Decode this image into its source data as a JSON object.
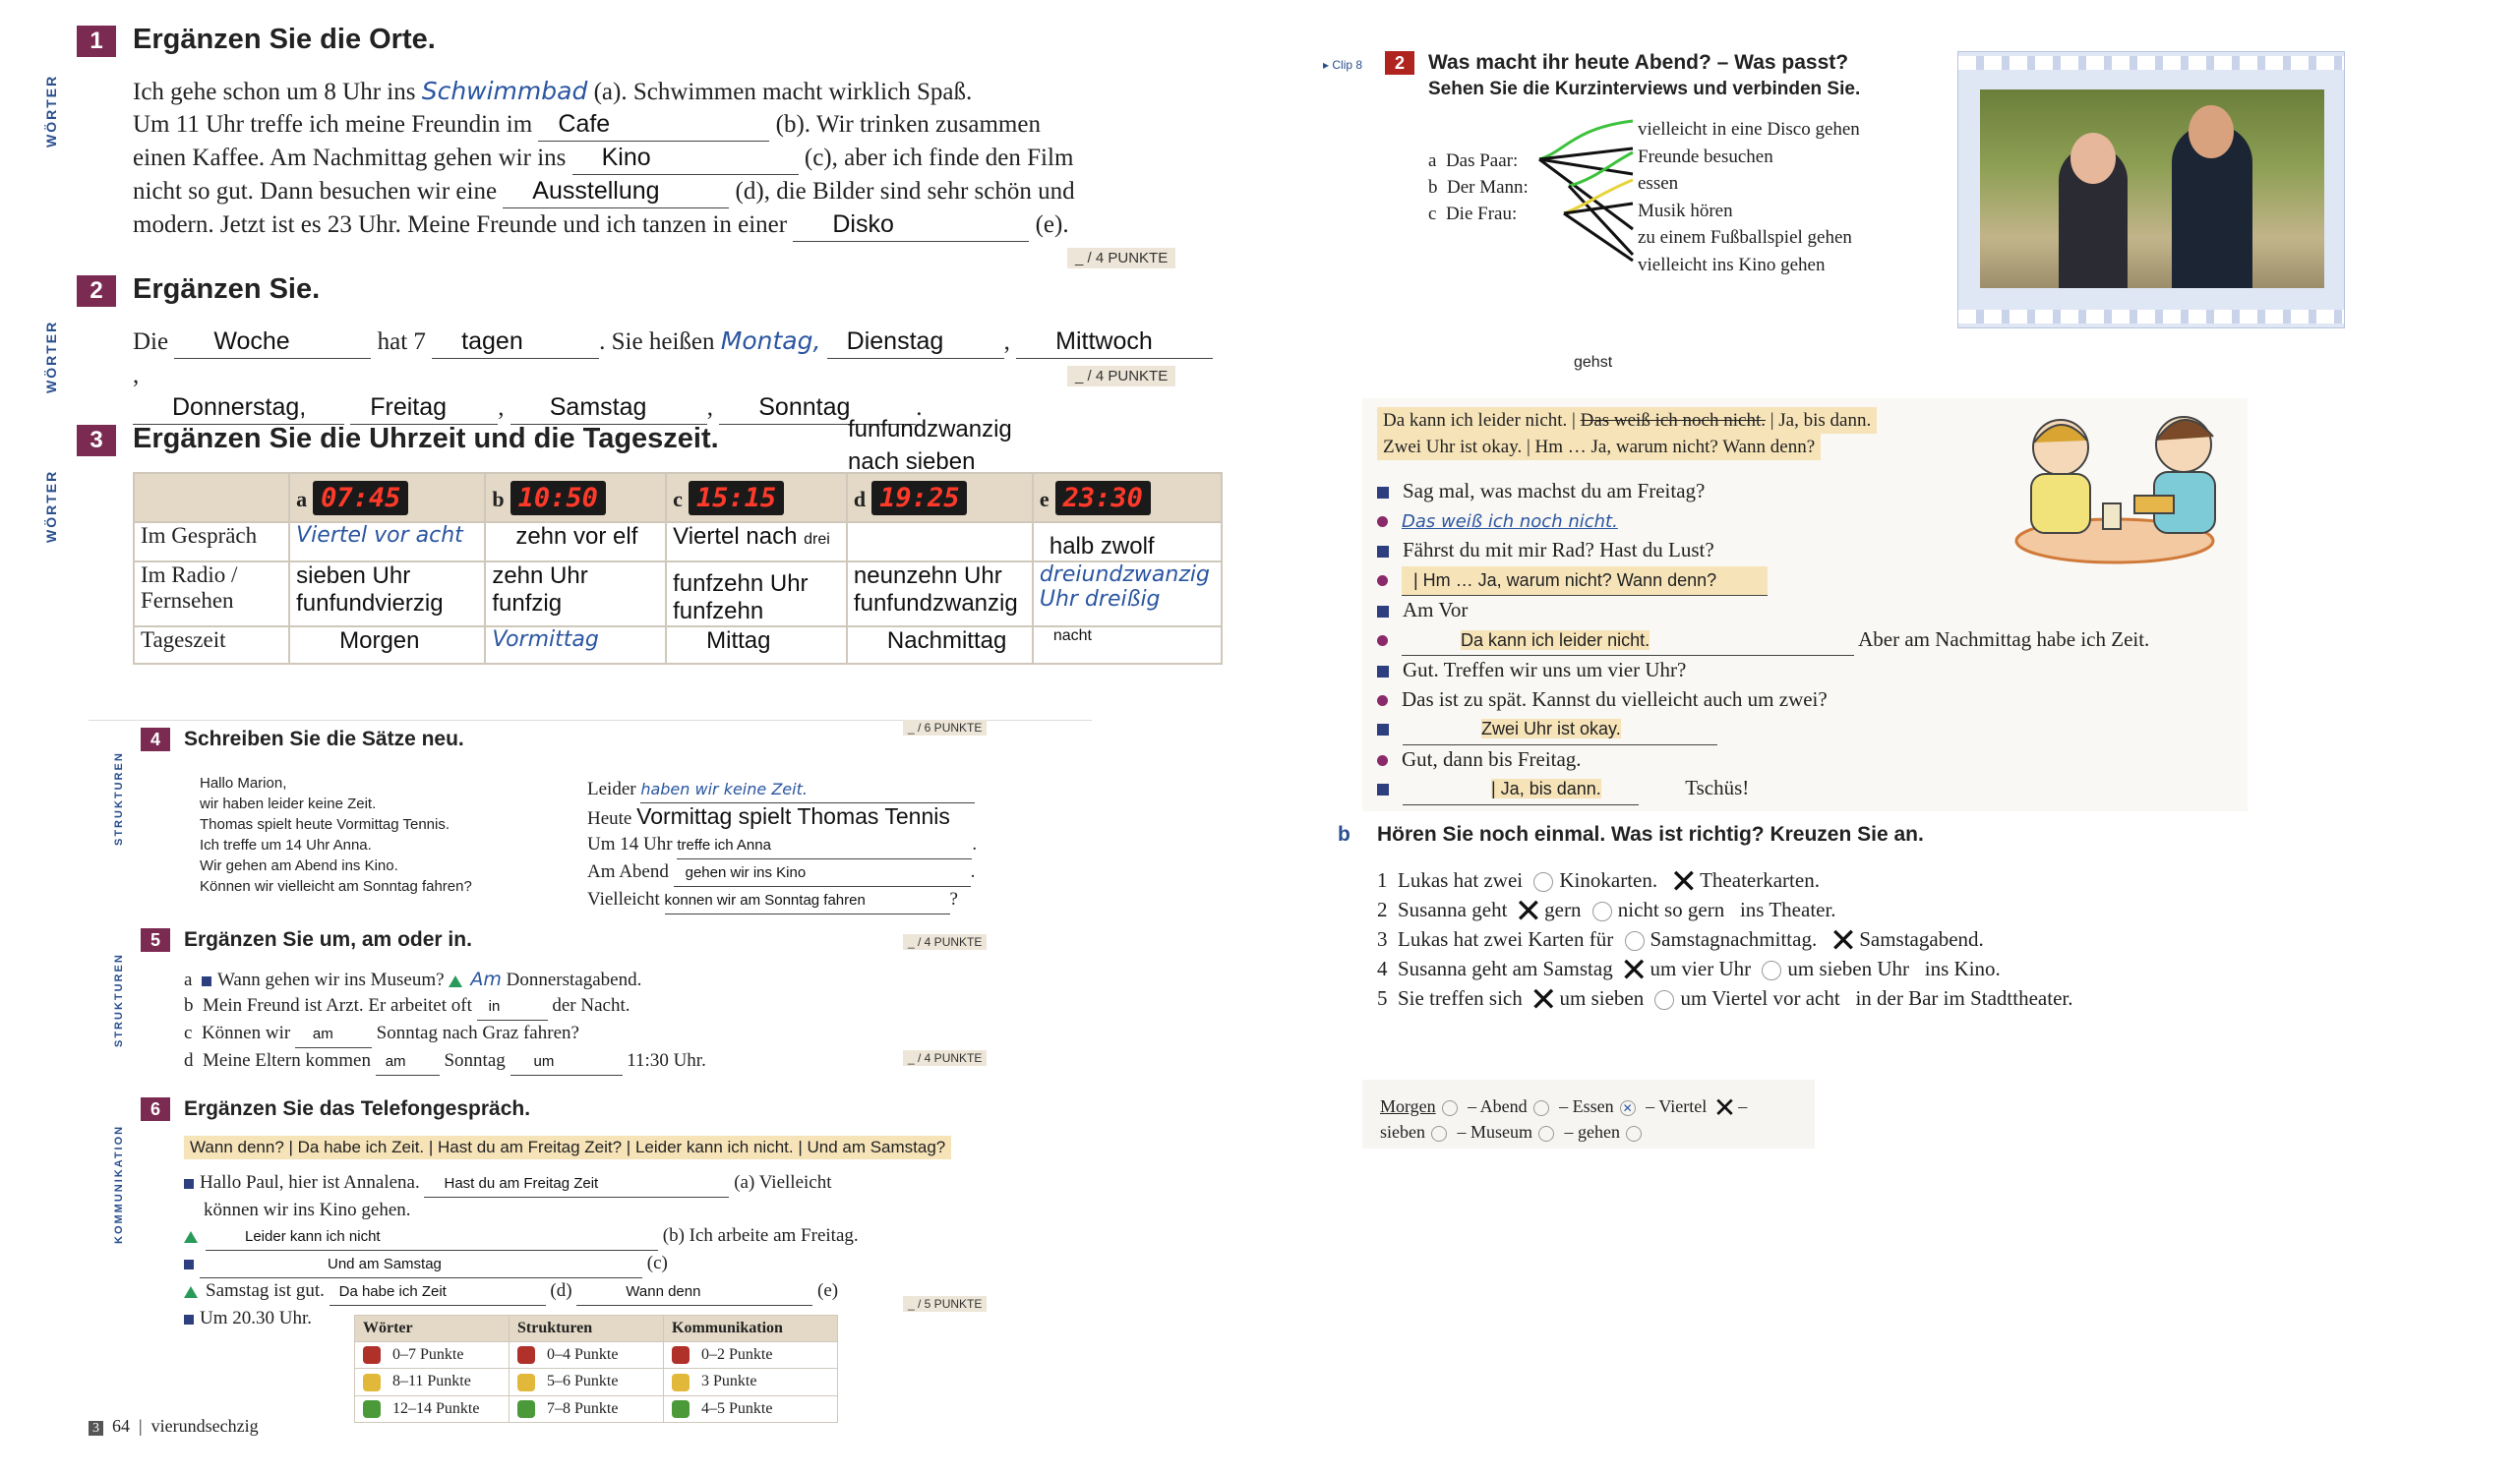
{
  "ex1": {
    "num": "1",
    "title": "Ergänzen Sie die Orte.",
    "side": "WÖRTER",
    "l1_pre": "Ich gehe schon um 8 Uhr ins",
    "l1_hand": "Schwimmbad",
    "l1_post": "(a). Schwimmen macht wirklich Spaß.",
    "l2_pre": "Um 11 Uhr treffe ich meine Freundin im",
    "l2_ans": "Cafe",
    "l2_post": "(b). Wir trinken zusammen",
    "l3_pre": "einen Kaffee. Am Nachmittag gehen wir ins",
    "l3_ans": "Kino",
    "l3_post": "(c), aber ich finde den Film",
    "l4_pre": "nicht so gut. Dann besuchen wir eine",
    "l4_ans": "Ausstellung",
    "l4_post": "(d), die Bilder sind sehr schön und",
    "l5_pre": "modern. Jetzt ist es 23 Uhr. Meine Freunde und ich tanzen in einer",
    "l5_ans": "Disko",
    "l5_post": "(e).",
    "punkte": "_ / 4 PUNKTE"
  },
  "ex2": {
    "num": "2",
    "title": "Ergänzen Sie.",
    "side": "WÖRTER",
    "die": "Die",
    "woche": "Woche",
    "hat7": "hat 7",
    "tagen": "tagen",
    "heissen": ". Sie heißen",
    "montag": "Montag,",
    "dienstag": "Dienstag",
    "comma1": ",",
    "mittwoch": "Mittwoch",
    "comma2": ",",
    "donnerstag": "Donnerstag,",
    "freitag": "Freitag",
    "comma3": ",",
    "samstag": "Samstag",
    "comma4": ",",
    "sonntag": "Sonntag",
    "dot": ".",
    "punkte": "_ / 4 PUNKTE"
  },
  "ex3": {
    "num": "3",
    "title": "Ergänzen Sie die Uhrzeit und die Tageszeit.",
    "side": "WÖRTER",
    "above_d": "funfundzwanzig nach sieben",
    "cols": [
      {
        "letter": "a",
        "clock": "07:45"
      },
      {
        "letter": "b",
        "clock": "10:50"
      },
      {
        "letter": "c",
        "clock": "15:15"
      },
      {
        "letter": "d",
        "clock": "19:25"
      },
      {
        "letter": "e",
        "clock": "23:30"
      }
    ],
    "row1_label": "Im Gespräch",
    "row1": [
      "Viertel vor acht",
      "zehn vor elf",
      "Viertel nach",
      "drei",
      "",
      "halb zwolf"
    ],
    "row2_label": "Im Radio / Fernsehen",
    "row2": [
      "sieben Uhr funfundvierzig",
      "zehn Uhr funfzig",
      "funfzehn Uhr funfzehn",
      "neunzehn Uhr funfundzwanzig",
      "dreiundzwanzig Uhr dreißig"
    ],
    "row3_label": "Tageszeit",
    "row3": [
      "Morgen",
      "Vormittag",
      "Mittag",
      "Nachmittag",
      "nacht"
    ]
  },
  "ex4": {
    "num": "4",
    "title": "Schreiben Sie die Sätze neu.",
    "side": "STRUKTUREN",
    "punkte": "_ / 6 PUNKTE",
    "letter": [
      "Hallo Marion,",
      "wir haben leider keine Zeit.",
      "Thomas spielt heute Vormittag Tennis.",
      "Ich treffe um 14 Uhr Anna.",
      "Wir gehen am Abend ins Kino.",
      "Können wir vielleicht am Sonntag fahren?"
    ],
    "r1_pre": "Leider",
    "r1_ans": "haben wir keine Zeit.",
    "r2_pre": "Heute",
    "r2_ans": "Vormittag spielt Thomas  Tennis",
    "r3_pre": "Um 14 Uhr",
    "r3_ans": "treffe ich Anna",
    "r3_post": ".",
    "r4_pre": "Am Abend",
    "r4_ans": "gehen wir ins Kino",
    "r4_post": ".",
    "r5_pre": "Vielleicht",
    "r5_ans": "konnen wir am Sonntag fahren",
    "r5_post": "?"
  },
  "ex5": {
    "num": "5",
    "title": "Ergänzen Sie um, am oder in.",
    "side": "STRUKTUREN",
    "punkte_top": "_ / 4 PUNKTE",
    "punkte_bot": "_ / 4 PUNKTE",
    "a_pre": "a",
    "a_q": "Wann gehen wir ins Museum?",
    "a_ans": "Am",
    "a_post": "Donnerstagabend.",
    "b_pre": "b",
    "b_q": "Mein Freund ist Arzt. Er arbeitet oft",
    "b_ans": "in",
    "b_post": "der Nacht.",
    "c_pre": "c",
    "c_q": "Können wir",
    "c_ans": "am",
    "c_post": "Sonntag nach Graz fahren?",
    "d_pre": "d",
    "d_q": "Meine Eltern kommen",
    "d_ans": "am",
    "d_mid": "Sonntag",
    "d_ans2": "um",
    "d_post": "11:30 Uhr."
  },
  "ex6": {
    "num": "6",
    "title": "Ergänzen Sie das Telefongespräch.",
    "side": "KOMMUNIKATION",
    "box": "Wann denn? | Da habe ich Zeit. | Hast du am Freitag Zeit? | Leider kann ich nicht. | Und am Samstag?",
    "l1_pre": "Hallo Paul, hier ist Annalena.",
    "l1_ans": "Hast du am Freitag Zeit",
    "l1_post": "(a) Vielleicht",
    "l1b": "können wir ins Kino gehen.",
    "l2_ans": "Leider kann ich nicht",
    "l2_post": "(b) Ich arbeite am Freitag.",
    "l3_ans": "Und am Samstag",
    "l3_post": "(c)",
    "l4_pre": "Samstag ist gut.",
    "l4_ans": "Da habe ich Zeit",
    "l4_mid": "(d)",
    "l4_ans2": "Wann denn",
    "l4_post": "(e)",
    "l5": "Um 20.30 Uhr.",
    "punkte": "_ / 5 PUNKTE"
  },
  "legend": {
    "headers": [
      "Wörter",
      "Strukturen",
      "Kommunikation"
    ],
    "rows": [
      [
        "0–7 Punkte",
        "0–4 Punkte",
        "0–2 Punkte"
      ],
      [
        "8–11 Punkte",
        "5–6 Punkte",
        "3 Punkte"
      ],
      [
        "12–14 Punkte",
        "7–8 Punkte",
        "4–5 Punkte"
      ]
    ],
    "colors": [
      "#b0302a",
      "#e2b83a",
      "#4a9a3a"
    ]
  },
  "footer": {
    "chapter": "3",
    "page": "64",
    "sep": "|",
    "word": "vierundsechzig"
  },
  "right": {
    "clip": "▸ Clip 8",
    "num": "2",
    "title": "Was macht ihr heute Abend? – Was passt?",
    "subtitle": "Sehen Sie die Kurzinterviews und verbinden Sie.",
    "left": [
      {
        "letter": "a",
        "text": "Das Paar:"
      },
      {
        "letter": "b",
        "text": "Der Mann:"
      },
      {
        "letter": "c",
        "text": "Die Frau:"
      }
    ],
    "options": [
      "vielleicht in eine Disco gehen",
      "Freunde besuchen",
      "essen",
      "Musik hören",
      "zu einem Fußballspiel gehen",
      "vielleicht ins Kino gehen"
    ],
    "gehst": "gehst",
    "box_a": "Da kann ich leider nicht. |",
    "box_strike": "Das weiß ich noch nicht.",
    "box_b": "| Ja, bis dann.",
    "box_c": "Zwei Uhr ist okay. |  Hm … Ja, warum nicht? Wann denn?",
    "d1": "Sag mal, was machst du am Freitag?",
    "d2": "Das weiß ich noch nicht.",
    "d3": "Fährst du mit mir Rad? Hast du Lust?",
    "d4": "| Hm … Ja, warum nicht? Wann denn?",
    "d5": "Am Vor",
    "d6": "Da kann ich leider nicht.",
    "d6_post": "Aber am Nachmittag habe ich Zeit.",
    "d7": "Gut. Treffen wir uns um vier Uhr?",
    "d8": "Das ist zu spät. Kannst du vielleicht auch um zwei?",
    "d9": "Zwei Uhr ist okay.",
    "d10": "Gut, dann bis Freitag.",
    "d11": "| Ja, bis dann.",
    "d11_post": "Tschüs!",
    "b_letter": "b",
    "b_title": "Hören Sie noch einmal. Was ist richtig? Kreuzen Sie an.",
    "q": [
      {
        "n": "1",
        "pre": "Lukas hat zwei",
        "o1": "Kinokarten.",
        "o2": "Theaterkarten.",
        "post": "",
        "mark": 2
      },
      {
        "n": "2",
        "pre": "Susanna geht",
        "o1": "gern",
        "o2": "nicht so gern",
        "post": "ins Theater.",
        "mark": 1
      },
      {
        "n": "3",
        "pre": "Lukas hat zwei Karten für",
        "o1": "Samstagnachmittag.",
        "o2": "Samstagabend.",
        "post": "",
        "mark": 2
      },
      {
        "n": "4",
        "pre": "Susanna geht am Samstag",
        "o1": "um vier Uhr",
        "o2": "um sieben Uhr",
        "post": "ins Kino.",
        "mark": 1
      },
      {
        "n": "5",
        "pre": "Sie treffen sich",
        "o1": "um sieben",
        "o2": "um Viertel vor acht",
        "post": "in der Bar im Stadttheater.",
        "mark": 1
      }
    ],
    "words_l1": [
      "Morgen",
      "– Abend",
      "– Essen",
      "– Viertel",
      "–"
    ],
    "words_l2": [
      "sieben",
      "– Museum",
      "– gehen"
    ]
  }
}
